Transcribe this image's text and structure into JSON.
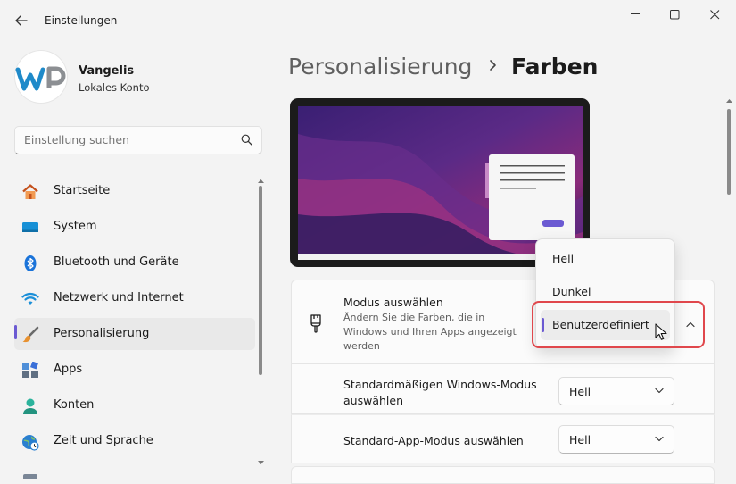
{
  "window": {
    "title": "Einstellungen"
  },
  "user": {
    "name": "Vangelis",
    "account": "Lokales Konto"
  },
  "search": {
    "placeholder": "Einstellung suchen"
  },
  "nav": [
    {
      "label": "Startseite",
      "icon": "home-icon"
    },
    {
      "label": "System",
      "icon": "system-icon"
    },
    {
      "label": "Bluetooth und Geräte",
      "icon": "bluetooth-icon"
    },
    {
      "label": "Netzwerk und Internet",
      "icon": "wifi-icon"
    },
    {
      "label": "Personalisierung",
      "icon": "brush-icon",
      "active": true
    },
    {
      "label": "Apps",
      "icon": "apps-icon"
    },
    {
      "label": "Konten",
      "icon": "account-icon"
    },
    {
      "label": "Zeit und Sprache",
      "icon": "clock-globe-icon"
    }
  ],
  "breadcrumb": {
    "parent": "Personalisierung",
    "current": "Farben"
  },
  "mode_setting": {
    "title": "Modus auswählen",
    "description": "Ändern Sie die Farben, die in Windows und Ihren Apps angezeigt werden",
    "options": [
      "Hell",
      "Dunkel",
      "Benutzerdefiniert"
    ],
    "selected": "Benutzerdefiniert"
  },
  "windows_mode_setting": {
    "title": "Standardmäßigen Windows-Modus auswählen",
    "value": "Hell"
  },
  "app_mode_setting": {
    "title": "Standard-App-Modus auswählen",
    "value": "Hell"
  },
  "colors": {
    "accent": "#6b5ad2",
    "highlight_border": "#e0474c"
  }
}
